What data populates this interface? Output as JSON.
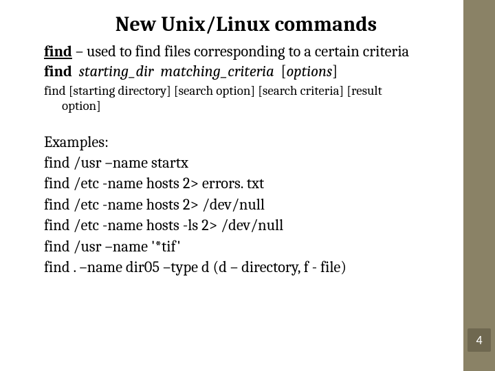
{
  "slide": {
    "title": "New Unix/Linux commands",
    "desc_lead_bold": "find",
    "desc_rest": " – used to find files corresponding to a certain criteria",
    "syntax": {
      "cmd_bold": "find",
      "arg1_ital": "starting_dir",
      "arg2_ital": "matching_criteria",
      "arg3_ital": "options"
    },
    "small_syntax_line1": "find [starting directory] [search option] [search criteria] [result",
    "small_syntax_line2": "option]",
    "examples_label": "Examples:",
    "examples": [
      "find /usr –name startx",
      "find /etc -name hosts 2> errors. txt",
      "find /etc -name hosts 2> /dev/null",
      "find /etc -name hosts -ls 2> /dev/null",
      "find /usr –name '*tif'",
      "find . –name dir05 –type d (d – directory, f - file)"
    ],
    "page_number": "4"
  }
}
